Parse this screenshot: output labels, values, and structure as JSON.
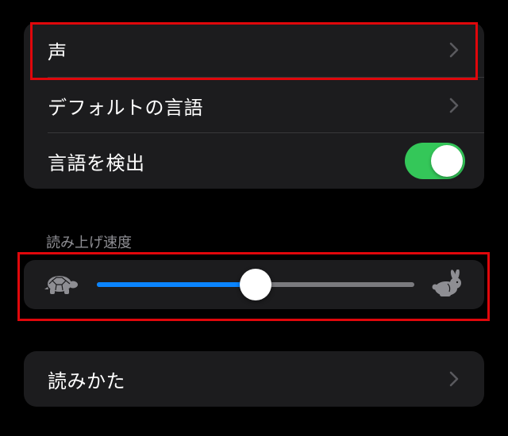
{
  "settings_group": {
    "items": [
      {
        "label": "声",
        "type": "link"
      },
      {
        "label": "デフォルトの言語",
        "type": "link"
      },
      {
        "label": "言語を検出",
        "type": "toggle",
        "on": true
      }
    ]
  },
  "speech_rate": {
    "header": "読み上げ速度",
    "value": 0.5,
    "min_icon": "turtle-icon",
    "max_icon": "rabbit-icon"
  },
  "pronunciations": {
    "label": "読みかた"
  },
  "colors": {
    "background": "#000000",
    "cell": "#1c1c1e",
    "toggle_on": "#34c759",
    "slider_fill": "#0a84ff",
    "slider_track": "#7a7a7e",
    "highlight": "#e0070b"
  }
}
